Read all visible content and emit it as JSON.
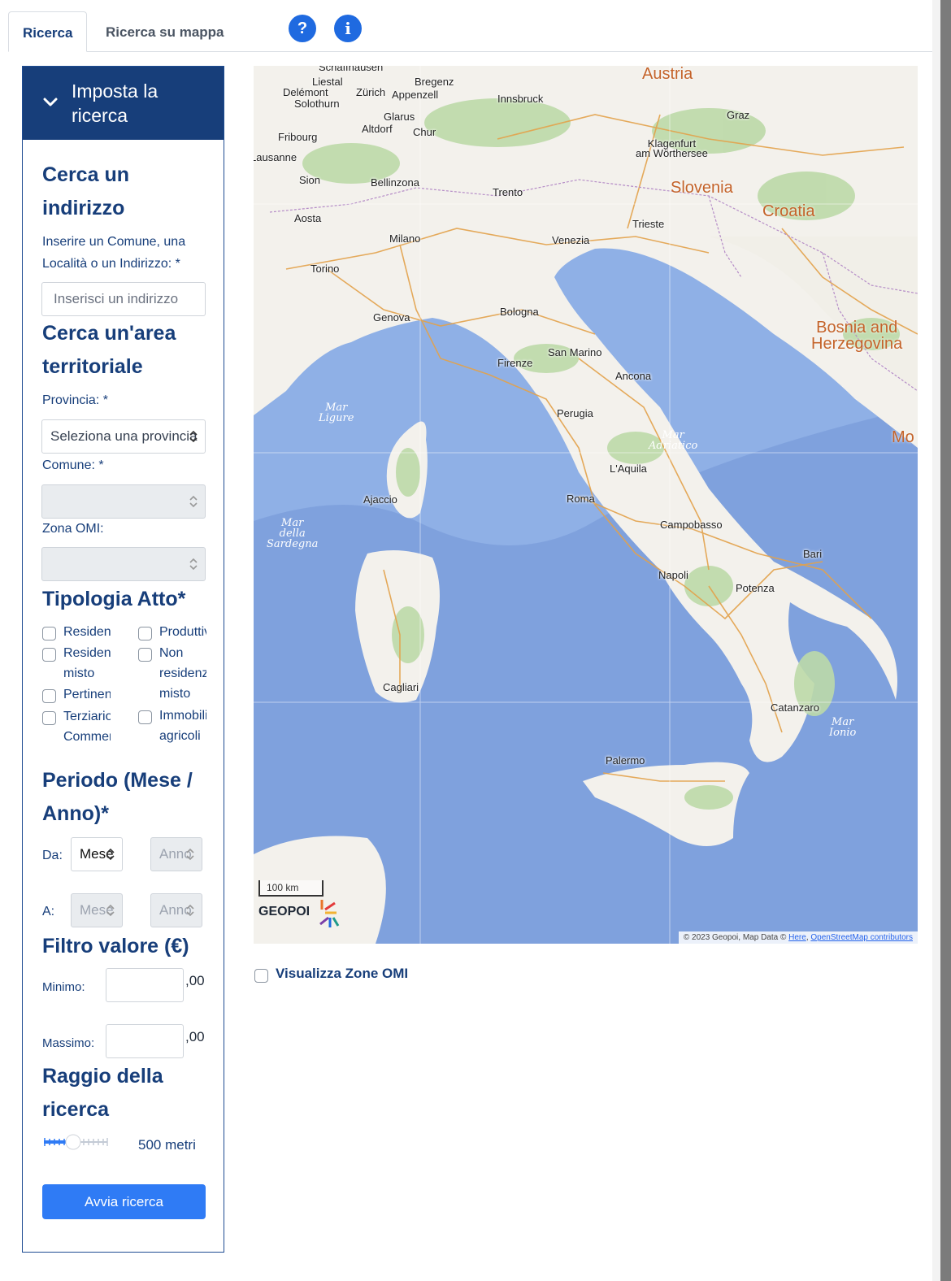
{
  "tabs": {
    "search": "Ricerca",
    "map_search": "Ricerca su mappa",
    "help_icon": "?",
    "info_icon": "i"
  },
  "panel": {
    "header": "Imposta la\nricerca",
    "address": {
      "title": "Cerca un\nindirizzo",
      "label": "Inserire un Comune, una Località o un Indirizzo: *",
      "placeholder": "Inserisci un indirizzo"
    },
    "area": {
      "title": "Cerca un'area\nterritoriale",
      "provincia_label": "Provincia: *",
      "provincia_value": "Seleziona una provincia",
      "comune_label": "Comune: *",
      "zona_label": "Zona OMI:"
    },
    "tipologia": {
      "title": "Tipologia Atto*",
      "options": [
        "Residenziale",
        "Produttivo",
        "Residenziale\nmisto",
        "Non\nresidenziale\nmisto",
        "Pertinenze",
        "Terziario\nCommerciale",
        "Immobili\nagricoli"
      ]
    },
    "periodo": {
      "title": "Periodo (Mese /\nAnno)*",
      "da": "Da:",
      "a": "A:",
      "mese": "Mese",
      "anno": "Anno"
    },
    "filtro": {
      "title": "Filtro valore (€)",
      "minimo": "Minimo:",
      "massimo": "Massimo:",
      "decimals": ",00"
    },
    "raggio": {
      "title": "Raggio della\nricerca",
      "value": "500 metri"
    },
    "submit": "Avvia ricerca"
  },
  "map": {
    "countries": [
      "Austria",
      "Slovenia",
      "Croatia",
      "Bosnia and\nHerzegovina",
      "Mo"
    ],
    "cities": [
      "Schaffhausen",
      "Liestal",
      "Delémont",
      "Solothurn",
      "Zürich",
      "Bregenz",
      "Appenzell",
      "Innsbruck",
      "Graz",
      "Glarus",
      "Altdorf",
      "Chur",
      "Fribourg",
      "Lausanne",
      "Sion",
      "Bellinzona",
      "Trento",
      "Klagenfurt\nam Wörthersee",
      "Aosta",
      "Trieste",
      "Milano",
      "Venezia",
      "Torino",
      "Genova",
      "Bologna",
      "San Marino",
      "Firenze",
      "Ancona",
      "Perugia",
      "L'Aquila",
      "Ajaccio",
      "Roma",
      "Campobasso",
      "Bari",
      "Napoli",
      "Potenza",
      "Cagliari",
      "Catanzaro",
      "Palermo"
    ],
    "seas": [
      "Mar\nLigure",
      "Mar\nAdriatico",
      "Mar\ndella\nSardegna",
      "Mar\nIonio"
    ],
    "scale": "100 km",
    "logo": "GEOPOI",
    "attribution_prefix": "© 2023 Geopoi, Map Data © ",
    "attribution_here": "Here",
    "attribution_sep": ", ",
    "attribution_osm": "OpenStreetMap contributors"
  },
  "omi_toggle": "Visualizza Zone OMI",
  "colors": {
    "primary": "#173e7a",
    "button": "#2f7bf5",
    "sea": "#8fb0e6",
    "land": "#f3f1ec"
  }
}
